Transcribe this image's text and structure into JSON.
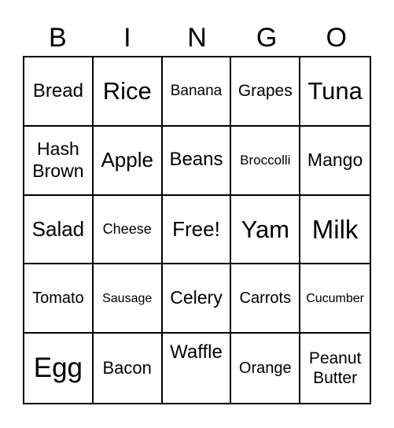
{
  "header": {
    "letters": [
      "B",
      "I",
      "N",
      "G",
      "O"
    ]
  },
  "card": {
    "rows": [
      [
        "Bread",
        "Rice",
        "Banana",
        "Grapes",
        "Tuna"
      ],
      [
        "Hash Brown",
        "Apple",
        "Beans",
        "Broccolli",
        "Mango"
      ],
      [
        "Salad",
        "Cheese",
        "Free!",
        "Yam",
        "Milk"
      ],
      [
        "Tomato",
        "Sausage",
        "Celery",
        "Carrots",
        "Cucumber"
      ],
      [
        "Egg",
        "Bacon",
        "Waffle",
        "Orange",
        "Peanut Butter"
      ]
    ]
  }
}
